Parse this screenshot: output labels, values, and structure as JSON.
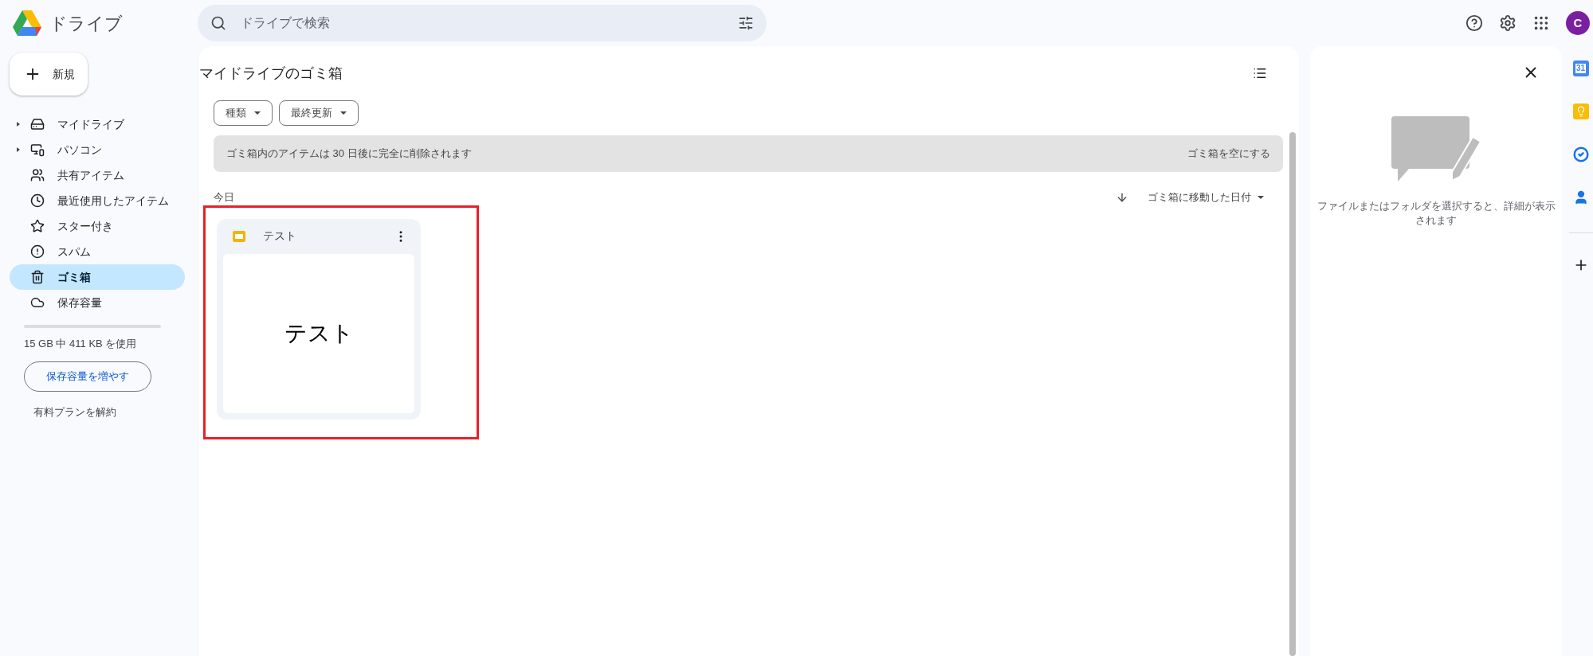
{
  "app": {
    "name": "ドライブ"
  },
  "search": {
    "placeholder": "ドライブで検索"
  },
  "account": {
    "initial": "C"
  },
  "new_button": "新規",
  "nav": [
    {
      "label": "マイドライブ",
      "kind": "drive",
      "expandable": true,
      "selected": false
    },
    {
      "label": "パソコン",
      "kind": "computers",
      "expandable": true,
      "selected": false
    },
    {
      "label": "共有アイテム",
      "kind": "shared",
      "expandable": false,
      "selected": false
    },
    {
      "label": "最近使用したアイテム",
      "kind": "recent",
      "expandable": false,
      "selected": false
    },
    {
      "label": "スター付き",
      "kind": "starred",
      "expandable": false,
      "selected": false
    },
    {
      "label": "スパム",
      "kind": "spam",
      "expandable": false,
      "selected": false
    },
    {
      "label": "ゴミ箱",
      "kind": "trash",
      "expandable": false,
      "selected": true
    },
    {
      "label": "保存容量",
      "kind": "storage",
      "expandable": false,
      "selected": false
    }
  ],
  "storage": {
    "usage": "15 GB 中 411 KB を使用",
    "upgrade": "保存容量を増やす",
    "cancel_plan": "有料プランを解約"
  },
  "main": {
    "title": "マイドライブのゴミ箱",
    "filters": [
      "種類",
      "最終更新"
    ],
    "notice": "ゴミ箱内のアイテムは 30 日後に完全に削除されます",
    "empty_trash": "ゴミ箱を空にする",
    "section": "今日",
    "sort": "ゴミ箱に移動した日付",
    "files": [
      {
        "name": "テスト",
        "preview": "テスト",
        "highlighted": true
      }
    ]
  },
  "details": {
    "message": "ファイルまたはフォルダを選択すると、詳細が表示されます"
  },
  "side_apps": [
    {
      "kind": "calendar",
      "label": "31"
    },
    {
      "kind": "keep"
    },
    {
      "kind": "tasks"
    },
    {
      "kind": "contacts"
    }
  ]
}
